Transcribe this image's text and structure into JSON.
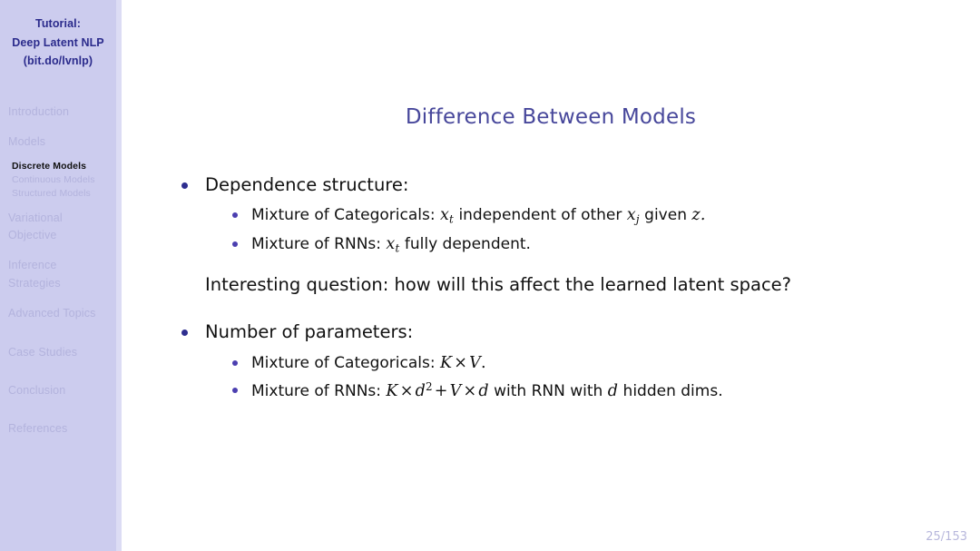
{
  "deck": {
    "title_lines": [
      "Tutorial:",
      "Deep Latent NLP",
      "(bit.do/lvnlp)"
    ]
  },
  "sidebar": {
    "sections": [
      {
        "label": "Introduction",
        "lines": [
          "Introduction"
        ],
        "active": false,
        "subitems": []
      },
      {
        "label": "Models",
        "lines": [
          "Models"
        ],
        "active": false,
        "subitems": [
          {
            "label": "Discrete Models",
            "active": true
          },
          {
            "label": "Continuous Models",
            "active": false
          },
          {
            "label": "Structured Models",
            "active": false
          }
        ]
      },
      {
        "label": "Variational Objective",
        "lines": [
          "Variational",
          "Objective"
        ],
        "active": false,
        "subitems": []
      },
      {
        "label": "Inference Strategies",
        "lines": [
          "Inference",
          "Strategies"
        ],
        "active": false,
        "subitems": []
      },
      {
        "label": "Advanced Topics",
        "lines": [
          "Advanced Topics"
        ],
        "active": false,
        "subitems": []
      },
      {
        "label": "Case Studies",
        "lines": [
          "Case Studies"
        ],
        "active": false,
        "subitems": []
      },
      {
        "label": "Conclusion",
        "lines": [
          "Conclusion"
        ],
        "active": false,
        "subitems": []
      },
      {
        "label": "References",
        "lines": [
          "References"
        ],
        "active": false,
        "subitems": []
      }
    ]
  },
  "slide": {
    "title": "Difference Between Models",
    "page_number": "25/153",
    "block1": {
      "heading": "Dependence structure:",
      "items": [
        {
          "prefix": "Mixture of Categoricals:",
          "math1_base": "x",
          "math1_sub": "t",
          "mid1": "independent of other",
          "math2_base": "x",
          "math2_sub": "j",
          "mid2": "given",
          "math3_base": "z",
          "suffix": "."
        },
        {
          "prefix": "Mixture of RNNs:",
          "math1_base": "x",
          "math1_sub": "t",
          "mid1": "fully dependent.",
          "math2_base": "",
          "math2_sub": "",
          "mid2": "",
          "math3_base": "",
          "suffix": ""
        }
      ],
      "question": "Interesting question:  how will this affect the learned latent space?"
    },
    "block2": {
      "heading": "Number of parameters:",
      "items": [
        {
          "prefix": "Mixture of Categoricals:",
          "mathK": "K",
          "times1": "×",
          "mathV": "V",
          "suffix": "."
        },
        {
          "prefix": "Mixture of RNNs:",
          "mathK": "K",
          "times1": "×",
          "mathd": "d",
          "exp": "2",
          "plus": "+",
          "mathV": "V",
          "times2": "×",
          "mathd2": "d",
          "mid": "with RNN with",
          "mathd3": "d",
          "suffix": "hidden dims."
        }
      ]
    }
  },
  "colors": {
    "sidebar_bg": "#ccccee",
    "sidebar_edge": "#dcdcf4",
    "title_blue": "#47479b",
    "deck_title_blue": "#2b2b8c",
    "nav_faded": "#b3b3dd",
    "nav_active": "#111111",
    "bullet1": "#2e2e8f",
    "bullet2": "#4b3fb0",
    "page_num": "#b7b7dc",
    "content_bg": "#ffffff",
    "body_text": "#111111"
  }
}
